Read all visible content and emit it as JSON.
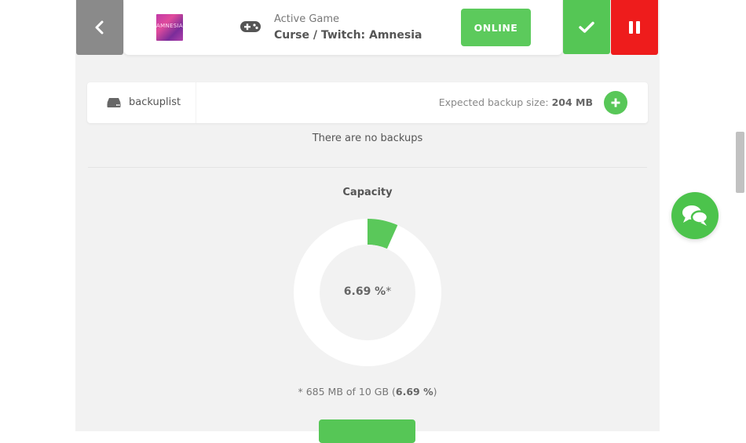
{
  "header": {
    "back_icon": "chevron-left-icon",
    "thumb_text": "AMNESIA",
    "gamepad_icon": "gamepad-icon",
    "active_label": "Active Game",
    "game_name": "Curse / Twitch: Amnesia",
    "status_button": "ONLINE",
    "confirm_icon": "check-icon",
    "pause_icon": "pause-icon",
    "colors": {
      "green": "#5cca5c",
      "red": "#ee1c1c",
      "grey": "#8a8a8a"
    }
  },
  "backups": {
    "tab_label": "backuplist",
    "expected_prefix": "Expected backup size: ",
    "expected_size": "204 MB",
    "add_icon": "plus-icon",
    "empty_text": "There are no backups"
  },
  "capacity": {
    "title": "Capacity",
    "percent_value": 6.69,
    "percent_label": "6.69 %",
    "asterisk": "*",
    "note_prefix": "* 685 MB of 10 GB (",
    "note_percent": "6.69 %",
    "note_suffix": ")"
  },
  "chat": {
    "icon": "chat-bubbles-icon"
  }
}
